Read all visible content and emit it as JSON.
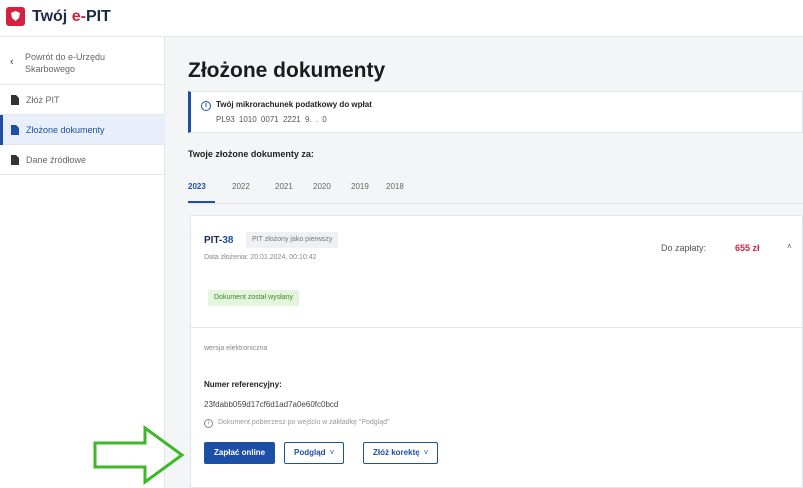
{
  "header": {
    "logo_title_prefix": "Twój ",
    "logo_title_accent": "e-",
    "logo_title_suffix": "PIT",
    "brand_color": "#d4213d"
  },
  "sidebar": {
    "back_label": "Powrót do e-Urzędu Skarbowego",
    "items": [
      {
        "label": "Złóż PIT",
        "icon": "document-icon",
        "active": false
      },
      {
        "label": "Złożone dokumenty",
        "icon": "document-icon",
        "active": true
      },
      {
        "label": "Dane źródłowe",
        "icon": "document-icon",
        "active": false
      }
    ]
  },
  "main": {
    "title": "Złożone dokumenty",
    "info": {
      "title": "Twój mikrorachunek podatkowy do wpłat",
      "value": "PL93 1010 0071 2221 9.        .    0"
    },
    "docs_for_label": "Twoje złożone dokumenty za:",
    "years": [
      "2023",
      "2022",
      "2021",
      "2020",
      "2019",
      "2018"
    ],
    "active_year": "2023",
    "card": {
      "pit_prefix": "PIT-",
      "pit_number": "38",
      "badge": "PIT złożony jako pierwszy",
      "file_date": "Data złożenia: 20.01.2024, 00:10:42",
      "to_pay_label": "Do zapłaty:",
      "to_pay_value": "655 zł",
      "status": "Dokument został wysłany",
      "version": "wersja elektroniczna",
      "ref_label": "Numer referencyjny:",
      "ref_value": "23fdabb059d17cf6d1ad7a0e60fc0bcd",
      "note": "Dokument pobierzesz po wejściu w zakładkę \"Podgląd\"",
      "buttons": {
        "pay": "Zapłać online",
        "preview": "Podgląd",
        "correct": "Złóż korektę"
      }
    }
  },
  "accent_color": "#1d4fa6",
  "arrow_color": "#3db827"
}
